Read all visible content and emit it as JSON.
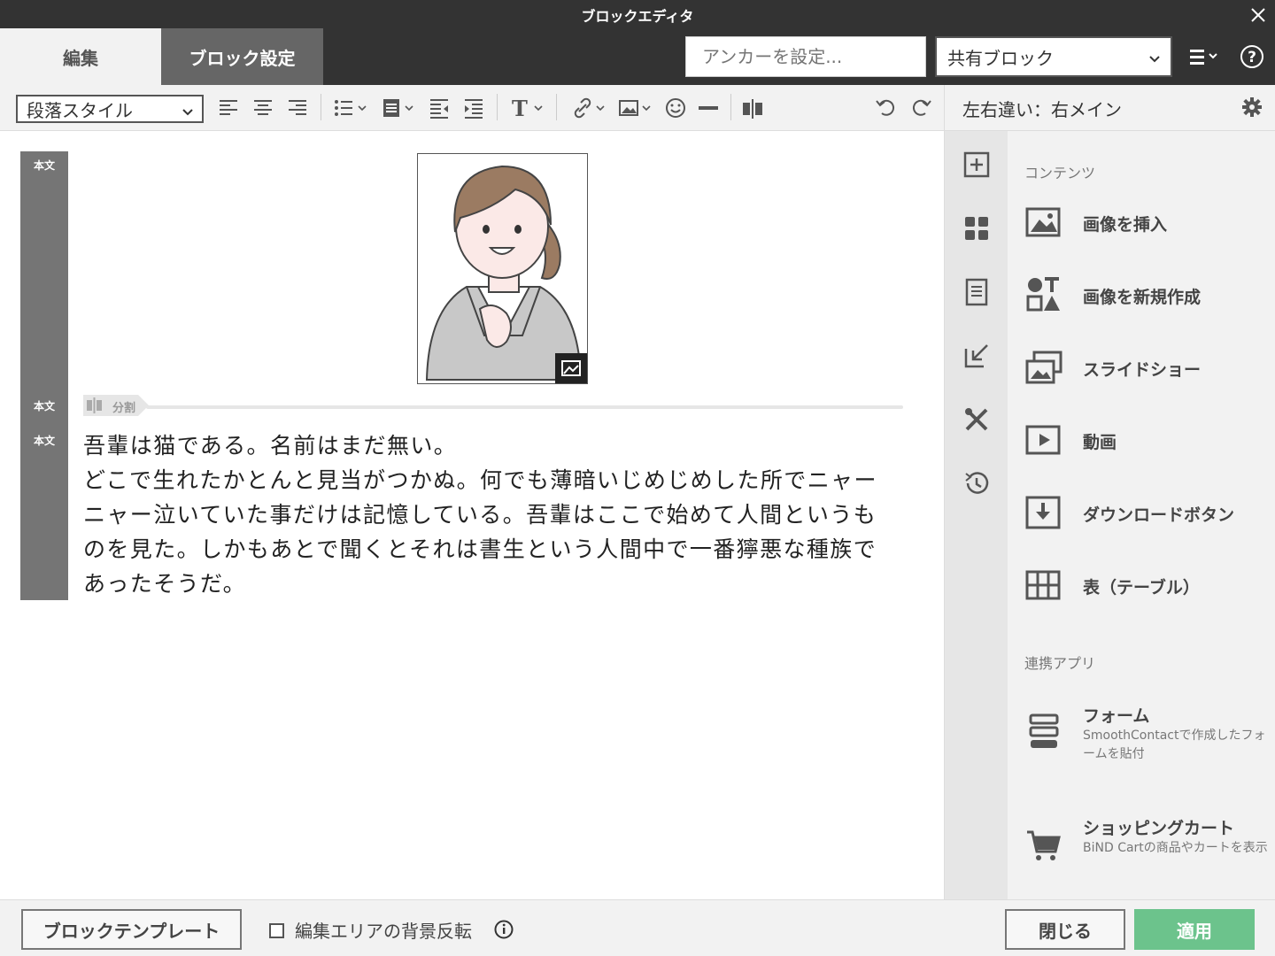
{
  "window": {
    "title": "ブロックエディタ"
  },
  "header": {
    "tabs": [
      {
        "label": "編集"
      },
      {
        "label": "ブロック設定"
      }
    ],
    "anchor_placeholder": "アンカーを設定...",
    "shared_block": "共有ブロック"
  },
  "toolbar": {
    "paragraph_style": "段落スタイル",
    "icons": [
      "align-left-icon",
      "align-center-icon",
      "align-right-icon",
      "list-icon",
      "block-format-icon",
      "outdent-icon",
      "indent-icon",
      "text-style-icon",
      "link-icon",
      "image-icon",
      "emoji-icon",
      "horizontal-rule-icon",
      "split-column-icon",
      "undo-icon",
      "redo-icon"
    ]
  },
  "canvas": {
    "strip_labels": [
      "本文",
      "本文",
      "本文"
    ],
    "divider_label": "分割",
    "body_lines": [
      "吾輩は猫である。名前はまだ無い。",
      "どこで生れたかとんと見当がつかぬ。何でも薄暗いじめじめした所でニャー",
      "ニャー泣いていた事だけは記憶している。吾輩はここで始めて人間というも",
      "のを見た。しかもあとで聞くとそれは書生という人間中で一番獰悪な種族で",
      "あったそうだ。"
    ]
  },
  "right_panel": {
    "title": "左右違い：右メイン",
    "rail_icons": [
      "add-icon",
      "blocks-icon",
      "page-icon",
      "import-icon",
      "tools-icon",
      "history-icon"
    ],
    "sections": {
      "contents": "コンテンツ",
      "apps": "連携アプリ"
    },
    "items": [
      {
        "label": "画像を挿入",
        "icon": "image-icon"
      },
      {
        "label": "画像を新規作成",
        "icon": "shapes-icon"
      },
      {
        "label": "スライドショー",
        "icon": "slideshow-icon"
      },
      {
        "label": "動画",
        "icon": "video-icon"
      },
      {
        "label": "ダウンロードボタン",
        "icon": "download-icon"
      },
      {
        "label": "表（テーブル）",
        "icon": "table-icon"
      }
    ],
    "apps": [
      {
        "label": "フォーム",
        "desc": "SmoothContactで作成したフォームを貼付",
        "icon": "form-icon"
      },
      {
        "label": "ショッピングカート",
        "desc": "BiND Cartの商品やカートを表示",
        "icon": "cart-icon"
      }
    ]
  },
  "footer": {
    "template_button": "ブロックテンプレート",
    "invert_checkbox_label": "編集エリアの背景反転",
    "close_button": "閉じる",
    "apply_button": "適用"
  },
  "colors": {
    "titlebar": "#333333",
    "active_tab": "#666666",
    "apply": "#6cc38c",
    "strip": "#757575"
  }
}
